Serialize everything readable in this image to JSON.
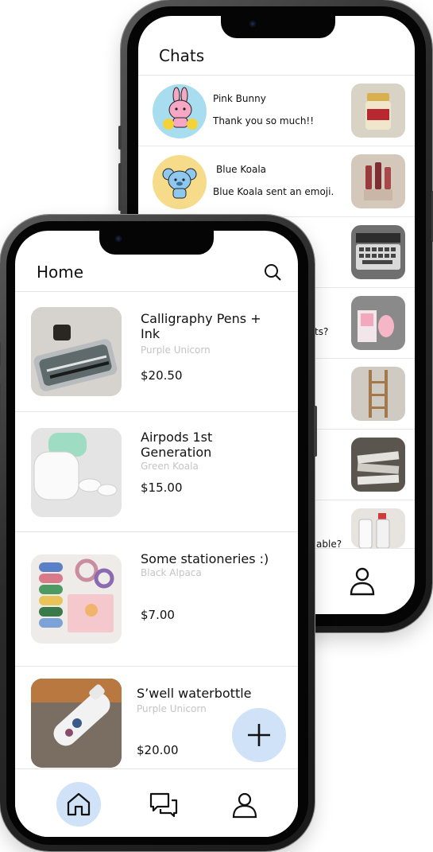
{
  "chats_screen": {
    "title": "Chats",
    "chats": [
      {
        "name": "Pink Bunny",
        "message": "Thank you so much!!",
        "avatar_icon": "pink-bunny-avatar",
        "item_icon": "jar-photo"
      },
      {
        "name": "Blue Koala",
        "message": "Blue Koala sent an emoji.",
        "avatar_icon": "blue-koala-avatar",
        "item_icon": "lipstick-photo"
      },
      {
        "name": "",
        "message": "",
        "item_icon": "keyboard-photo"
      },
      {
        "name": "",
        "message": "ts?",
        "item_icon": "pink-gadget-photo"
      },
      {
        "name": "",
        "message": "",
        "item_icon": "shelf-photo"
      },
      {
        "name": "",
        "message": "",
        "item_icon": "papers-photo"
      },
      {
        "name": "",
        "message": "ailable?",
        "item_icon": "spray-bottle-photo"
      }
    ]
  },
  "home_screen": {
    "title": "Home",
    "search_icon": "search-icon",
    "products": [
      {
        "title": "Calligraphy Pens + Ink",
        "seller": "Purple Unicorn",
        "price": "$20.50",
        "image_icon": "pens-photo"
      },
      {
        "title": "Airpods 1st Generation",
        "seller": "Green Koala",
        "price": "$15.00",
        "image_icon": "airpods-photo"
      },
      {
        "title": "Some stationeries :)",
        "seller": "Black Alpaca",
        "price": "$7.00",
        "image_icon": "stationery-photo"
      },
      {
        "title": "S’well waterbottle",
        "seller": "Purple Unicorn",
        "price": "$20.00",
        "image_icon": "bottle-photo"
      }
    ],
    "fab_icon": "plus-icon",
    "nav": [
      {
        "name": "home",
        "icon": "home-icon",
        "active": true
      },
      {
        "name": "chats",
        "icon": "chat-icon",
        "active": false
      },
      {
        "name": "profile",
        "icon": "user-icon",
        "active": false
      }
    ]
  },
  "colors": {
    "accent": "#cfe2f8",
    "muted_text": "#c4c4c4",
    "text": "#111111"
  }
}
